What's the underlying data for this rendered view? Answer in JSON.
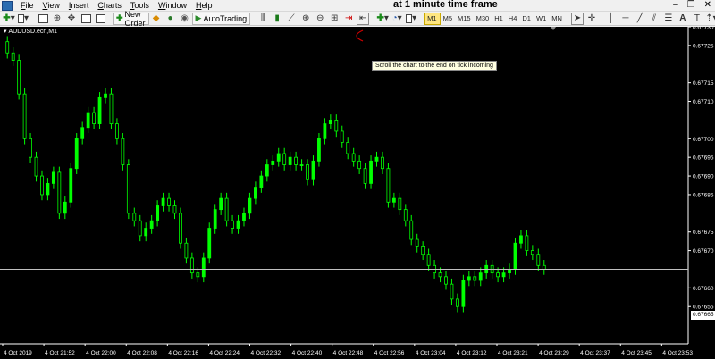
{
  "menu": {
    "items": [
      "File",
      "View",
      "Insert",
      "Charts",
      "Tools",
      "Window",
      "Help"
    ],
    "title_overlay": "at 1 minute time frame"
  },
  "toolbar": {
    "new_order": "New Order",
    "autotrading": "AutoTrading",
    "timeframes": [
      "M1",
      "M5",
      "M15",
      "M30",
      "H1",
      "H4",
      "D1",
      "W1",
      "MN"
    ],
    "active_timeframe": "M1"
  },
  "chart": {
    "symbol_label": "AUDUSD.ecn,M1",
    "tooltip": "Scroll the chart to the end on tick incoming",
    "current_price": "0.67665",
    "colors": {
      "background": "#000000",
      "bull": "#00ff00",
      "bear": "#ffffff",
      "axis": "#ffffff",
      "bid_line": "#c0c0c0"
    }
  },
  "chart_data": {
    "type": "candlestick",
    "ylim": [
      0.67645,
      0.6773
    ],
    "y_ticks": [
      "0.67730",
      "0.67725",
      "0.67715",
      "0.67710",
      "0.67700",
      "0.67695",
      "0.67690",
      "0.67685",
      "0.67675",
      "0.67670",
      "0.67660",
      "0.67655"
    ],
    "x_ticks": [
      "4 Oct 2019",
      "4 Oct 21:52",
      "4 Oct 22:00",
      "4 Oct 22:08",
      "4 Oct 22:16",
      "4 Oct 22:24",
      "4 Oct 22:32",
      "4 Oct 22:40",
      "4 Oct 22:48",
      "4 Oct 22:56",
      "4 Oct 23:04",
      "4 Oct 23:12",
      "4 Oct 23:21",
      "4 Oct 23:29",
      "4 Oct 23:37",
      "4 Oct 23:45",
      "4 Oct 23:53"
    ],
    "bid": 0.67665,
    "closes": [
      0.67723,
      0.67721,
      0.67712,
      0.677,
      0.67695,
      0.6769,
      0.67685,
      0.67688,
      0.67691,
      0.6768,
      0.67683,
      0.67692,
      0.677,
      0.67703,
      0.67707,
      0.67704,
      0.67711,
      0.67712,
      0.67704,
      0.677,
      0.67693,
      0.6768,
      0.67678,
      0.67674,
      0.67676,
      0.67678,
      0.67682,
      0.67684,
      0.67682,
      0.6768,
      0.67672,
      0.67668,
      0.67664,
      0.67663,
      0.67668,
      0.67676,
      0.67681,
      0.67684,
      0.67678,
      0.67676,
      0.67678,
      0.6768,
      0.67684,
      0.67687,
      0.6769,
      0.67693,
      0.67694,
      0.67696,
      0.67693,
      0.67695,
      0.67693,
      0.67693,
      0.67689,
      0.67694,
      0.677,
      0.67704,
      0.67705,
      0.67702,
      0.67699,
      0.67696,
      0.67694,
      0.67692,
      0.67688,
      0.67694,
      0.67695,
      0.67692,
      0.67683,
      0.67684,
      0.67681,
      0.67678,
      0.67673,
      0.67671,
      0.67669,
      0.67666,
      0.67664,
      0.67663,
      0.67661,
      0.67657,
      0.67655,
      0.67662,
      0.67663,
      0.67662,
      0.67664,
      0.67666,
      0.67664,
      0.67663,
      0.67664,
      0.67665,
      0.67672,
      0.67674,
      0.6767,
      0.67669,
      0.67666,
      0.67665
    ],
    "opens": [
      0.67726,
      0.67723,
      0.67721,
      0.67712,
      0.677,
      0.67695,
      0.6769,
      0.67685,
      0.67688,
      0.67691,
      0.6768,
      0.67683,
      0.67692,
      0.677,
      0.67703,
      0.67707,
      0.67704,
      0.67711,
      0.67712,
      0.67704,
      0.677,
      0.67693,
      0.6768,
      0.67678,
      0.67674,
      0.67676,
      0.67678,
      0.67682,
      0.67684,
      0.67682,
      0.6768,
      0.67672,
      0.67668,
      0.67664,
      0.67663,
      0.67668,
      0.67676,
      0.67681,
      0.67684,
      0.67678,
      0.67676,
      0.67678,
      0.6768,
      0.67684,
      0.67687,
      0.6769,
      0.67693,
      0.67694,
      0.67696,
      0.67693,
      0.67695,
      0.67693,
      0.67693,
      0.67689,
      0.67694,
      0.677,
      0.67704,
      0.67705,
      0.67702,
      0.67699,
      0.67696,
      0.67694,
      0.67692,
      0.67688,
      0.67694,
      0.67695,
      0.67692,
      0.67683,
      0.67684,
      0.67681,
      0.67678,
      0.67673,
      0.67671,
      0.67669,
      0.67666,
      0.67664,
      0.67663,
      0.67661,
      0.67657,
      0.67655,
      0.67662,
      0.67663,
      0.67662,
      0.67664,
      0.67666,
      0.67664,
      0.67663,
      0.67664,
      0.67665,
      0.67672,
      0.67674,
      0.6767,
      0.67669,
      0.67666
    ]
  }
}
